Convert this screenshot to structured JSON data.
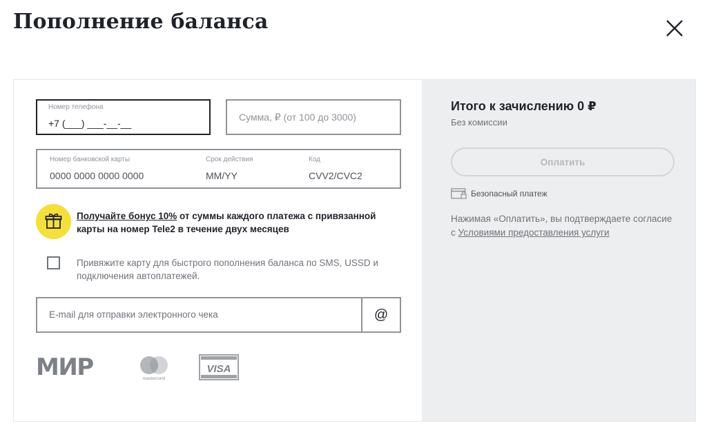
{
  "page": {
    "title": "Пополнение баланса"
  },
  "form": {
    "phone": {
      "label": "Номер телефона",
      "value": "+7 (___) ___-__-__"
    },
    "amount": {
      "placeholder": "Сумма, ₽ (от 100 до 3000)"
    },
    "card": {
      "number_label": "Номер банковской карты",
      "number_placeholder": "0000 0000 0000 0000",
      "expiry_label": "Срок действия",
      "expiry_placeholder": "MM/YY",
      "code_label": "Код",
      "code_placeholder": "CVV2/CVC2"
    },
    "bonus": {
      "link": "Получайте бонус 10%",
      "text": " от суммы каждого платежа с привязанной карты на номер Tele2 в течение двух месяцев",
      "icon": "gift-icon"
    },
    "bind_card": {
      "checked": false,
      "label": "Привяжите карту для быстрого пополнения баланса по SMS, USSD и подключения автоплатежей."
    },
    "email": {
      "placeholder": "E-mail для отправки электронного чека",
      "button": "@"
    },
    "payment_systems": [
      {
        "name": "МИР",
        "icon": "mir-logo"
      },
      {
        "name": "mastercard",
        "icon": "mastercard-logo"
      },
      {
        "name": "VISA",
        "icon": "visa-logo"
      }
    ]
  },
  "summary": {
    "total": "Итого к зачислению 0 ₽",
    "commission": "Без комиссии",
    "pay_button": "Оплатить",
    "secure": "Безопасный платеж",
    "agree_prefix": "Нажимая «Оплатить», вы подтверждаете согласие с ",
    "agree_link": "Условиями предоставления услуги"
  },
  "colors": {
    "text": "#1f2229",
    "muted": "#6e737a",
    "accent": "#f5e03a",
    "panel": "#eceeef"
  }
}
